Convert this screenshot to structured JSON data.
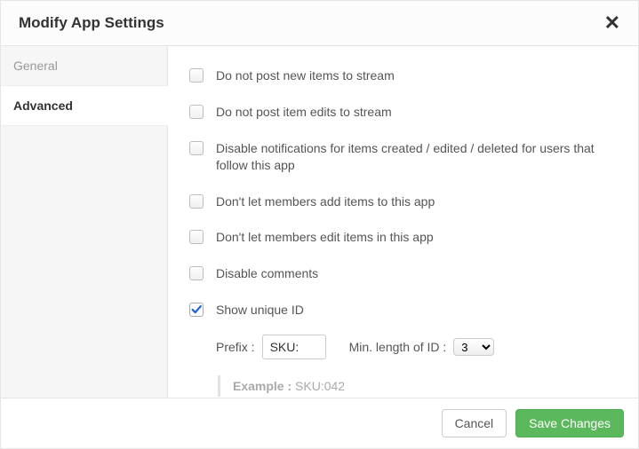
{
  "header": {
    "title": "Modify App Settings"
  },
  "sidebar": {
    "tabs": [
      {
        "label": "General",
        "active": false
      },
      {
        "label": "Advanced",
        "active": true
      }
    ]
  },
  "settings": {
    "items": [
      {
        "label": "Do not post new items to stream",
        "checked": false
      },
      {
        "label": "Do not post item edits to stream",
        "checked": false
      },
      {
        "label": "Disable notifications for items created / edited / deleted for users that follow this app",
        "checked": false
      },
      {
        "label": "Don't let members add items to this app",
        "checked": false
      },
      {
        "label": "Don't let members edit items in this app",
        "checked": false
      },
      {
        "label": "Disable comments",
        "checked": false
      },
      {
        "label": "Show unique ID",
        "checked": true
      }
    ],
    "prefix": {
      "label": "Prefix :",
      "value": "SKU:"
    },
    "minLength": {
      "label": "Min. length of ID :",
      "value": "3"
    },
    "example": {
      "label": "Example :",
      "value": "SKU:042"
    }
  },
  "footer": {
    "cancel": "Cancel",
    "save": "Save Changes"
  }
}
